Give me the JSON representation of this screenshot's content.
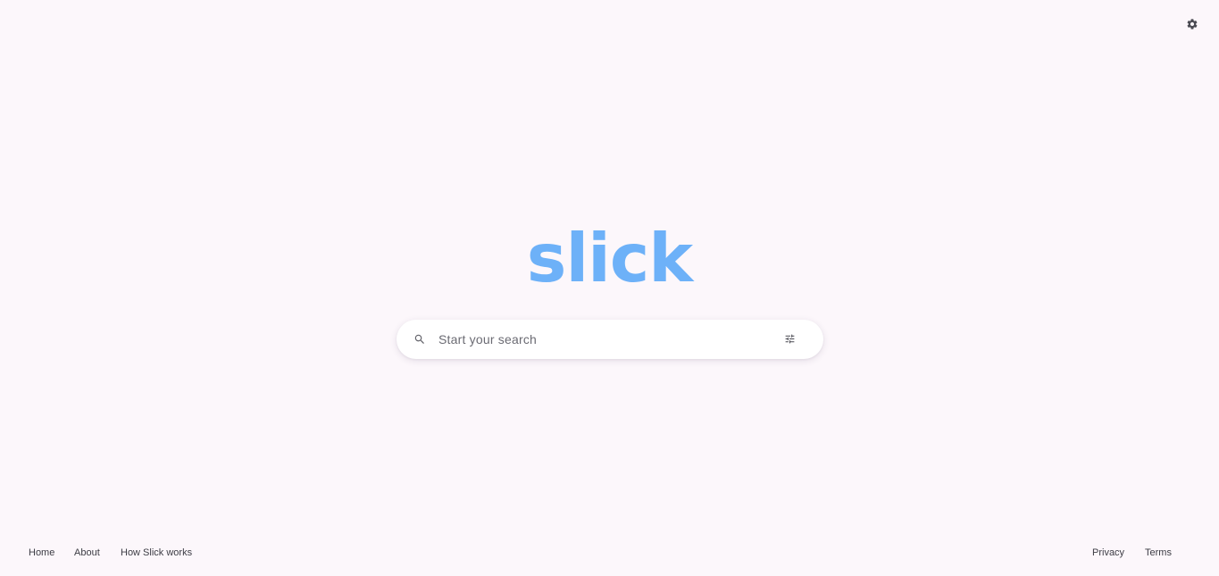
{
  "header": {
    "settings_icon": "gear-icon"
  },
  "logo": {
    "text": "slick",
    "color": "#6db1f8"
  },
  "search": {
    "placeholder": "Start your search",
    "value": "",
    "search_icon": "search-icon",
    "filter_icon": "tune-sliders-icon"
  },
  "footer": {
    "left_links": [
      "Home",
      "About",
      "How Slick works"
    ],
    "right_links": [
      "Privacy",
      "Terms"
    ]
  },
  "colors": {
    "background": "#fcf7fb",
    "accent": "#6db1f8",
    "text": "#3c3c44"
  }
}
